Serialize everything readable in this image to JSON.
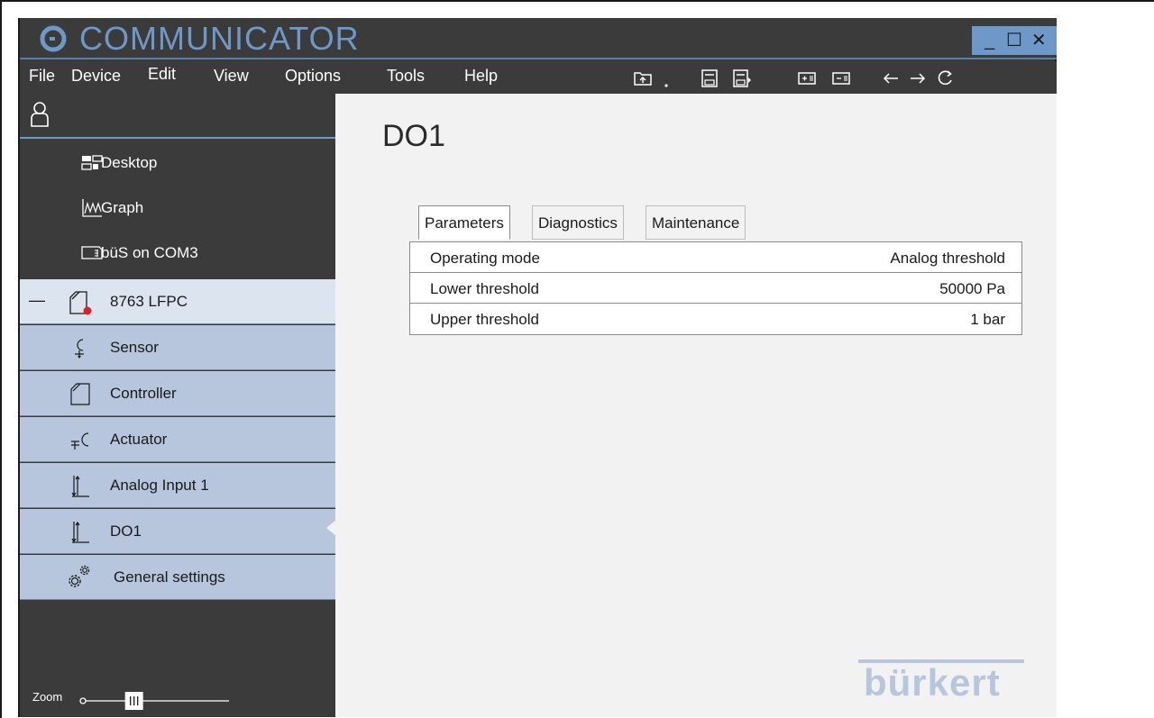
{
  "app": {
    "title": "COMMUNICATOR",
    "window_controls": {
      "minimize": "_",
      "maximize": "☐",
      "close": "✕"
    },
    "accent_color": "#6d98c8"
  },
  "menu": {
    "items": [
      "File",
      "Device",
      "Edit",
      "View",
      "Options",
      "Tools",
      "Help"
    ],
    "toolbar_icons": [
      "open-folder-icon",
      "save-icon",
      "save-as-icon",
      "add-device-icon",
      "remove-device-icon",
      "back-arrow-icon",
      "forward-arrow-icon",
      "refresh-icon"
    ]
  },
  "sidebar": {
    "user_icon": "user-icon",
    "nav": [
      {
        "label": "Desktop",
        "icon": "desktop-icon"
      },
      {
        "label": "Graph",
        "icon": "graph-icon"
      },
      {
        "label": "büS on COM3",
        "icon": "bus-port-icon"
      }
    ],
    "device": {
      "label": "8763 LFPC",
      "collapse": "—",
      "status_color": "#e02020"
    },
    "tree": [
      {
        "label": "Sensor",
        "icon": "sensor-icon"
      },
      {
        "label": "Controller",
        "icon": "controller-icon"
      },
      {
        "label": "Actuator",
        "icon": "actuator-icon"
      },
      {
        "label": "Analog Input 1",
        "icon": "analog-input-icon"
      },
      {
        "label": "DO1",
        "icon": "digital-output-icon",
        "selected": true
      },
      {
        "label": "General settings",
        "icon": "gears-icon"
      }
    ],
    "zoom": {
      "label": "Zoom",
      "level": 0.35
    }
  },
  "main": {
    "title": "DO1",
    "tabs": [
      "Parameters",
      "Diagnostics",
      "Maintenance"
    ],
    "active_tab": "Parameters",
    "parameters": [
      {
        "name": "Operating mode",
        "value": "Analog threshold"
      },
      {
        "name": "Lower threshold",
        "value": "50000 Pa"
      },
      {
        "name": "Upper threshold",
        "value": "1 bar"
      }
    ],
    "brand": "bürkert"
  }
}
